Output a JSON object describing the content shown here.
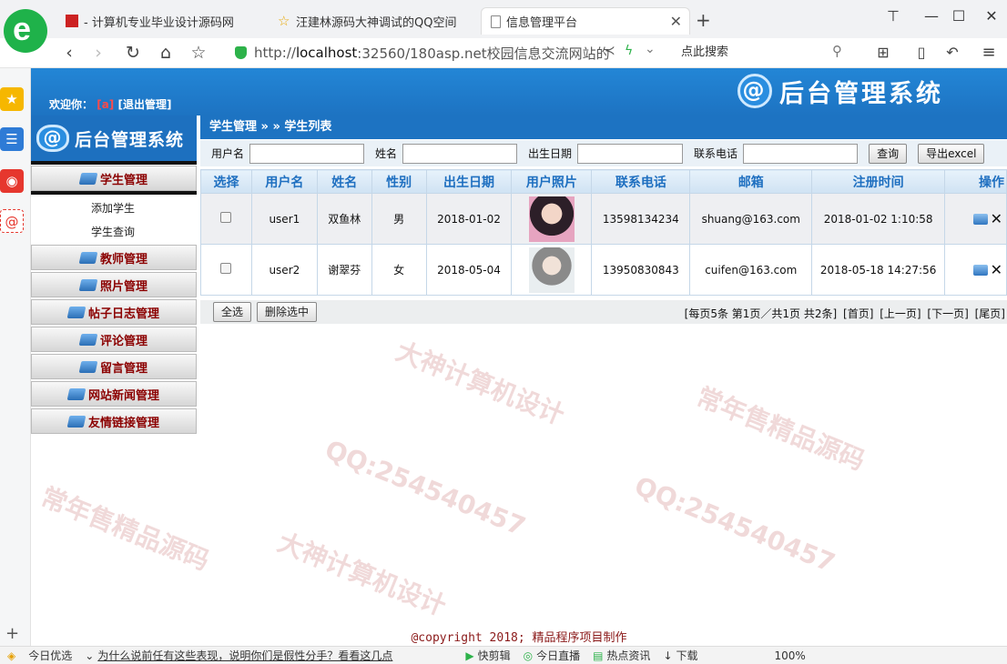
{
  "browser": {
    "tabs": [
      {
        "title": "- 计算机专业毕业设计源码网",
        "active": false
      },
      {
        "title": "汪建林源码大神调试的QQ空间",
        "active": false
      },
      {
        "title": "信息管理平台",
        "active": true
      }
    ],
    "new_tab": "+",
    "url_prefix": "http://",
    "url_host": "localhost",
    "url_rest": ":32560/180asp.net校园信息交流网站的",
    "search_placeholder": "点此搜索"
  },
  "header": {
    "welcome_label": "欢迎你：",
    "user": "[a]",
    "logout": "[退出管理]",
    "banner_title": "后台管理系统",
    "logo_glyph": "@"
  },
  "menu": {
    "title": "后台管理系统",
    "items": [
      {
        "label": "学生管理",
        "children": [
          "添加学生",
          "学生查询"
        ]
      },
      {
        "label": "教师管理"
      },
      {
        "label": "照片管理"
      },
      {
        "label": "帖子日志管理"
      },
      {
        "label": "评论管理"
      },
      {
        "label": "留言管理"
      },
      {
        "label": "网站新闻管理"
      },
      {
        "label": "友情链接管理"
      }
    ]
  },
  "breadcrumb": "学生管理 » » 学生列表",
  "filter": {
    "username_label": "用户名",
    "name_label": "姓名",
    "birth_label": "出生日期",
    "phone_label": "联系电话",
    "search_button": "查询",
    "export_button": "导出excel"
  },
  "table": {
    "headers": [
      "选择",
      "用户名",
      "姓名",
      "性别",
      "出生日期",
      "用户照片",
      "联系电话",
      "邮箱",
      "注册时间",
      "操作"
    ],
    "rows": [
      {
        "username": "user1",
        "name": "双鱼林",
        "gender": "男",
        "birth": "2018-01-02",
        "phone": "13598134234",
        "email": "shuang@163.com",
        "reg_time": "2018-01-02 1:10:58"
      },
      {
        "username": "user2",
        "name": "谢翠芬",
        "gender": "女",
        "birth": "2018-05-04",
        "phone": "13950830843",
        "email": "cuifen@163.com",
        "reg_time": "2018-05-18 14:27:56"
      }
    ]
  },
  "footer_bar": {
    "select_all": "全选",
    "delete_selected": "删除选中",
    "pager_info": "[每页5条 第1页／共1页 共2条]",
    "first": "[首页]",
    "prev": "[上一页]",
    "next": "[下一页]",
    "last": "[尾页]"
  },
  "copyright": "@copyright 2018; 精品程序项目制作",
  "statusbar": {
    "left": "今日优选",
    "news": "为什么说前任有这些表现，说明你们是假性分手？看看这几点",
    "clip": "快剪辑",
    "live": "今日直播",
    "hot": "热点资讯",
    "download": "下载",
    "zoom": "100%"
  },
  "watermarks": [
    "QQ:254540457",
    "大神计算机设计",
    "常年售精品源码"
  ]
}
